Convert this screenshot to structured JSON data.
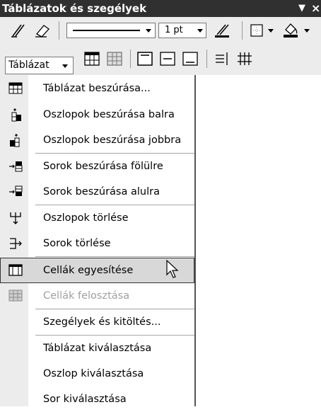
{
  "toolbar": {
    "title": "Táblázatok és szegélyek",
    "title_buttons": {
      "dropdown": "▼",
      "close": "×"
    },
    "line_weight": "1 pt",
    "tablazat_label": "Táblázat",
    "icons": [
      "pencil-icon",
      "eraser-icon",
      "line-style-dropdown",
      "line-weight-dropdown",
      "border-color-icon",
      "borders-icon",
      "shading-color-icon",
      "insert-table-icon",
      "merge-cells-icon",
      "split-cells-icon",
      "align-top-icon",
      "align-center-icon",
      "align-bottom-icon",
      "distribute-rows-icon",
      "distribute-columns-icon"
    ]
  },
  "menu": {
    "items": [
      {
        "label": "Táblázat beszúrása...",
        "icon": "insert-table-icon",
        "enabled": true
      },
      {
        "label": "Oszlopok beszúrása balra",
        "icon": "insert-columns-left-icon",
        "enabled": true
      },
      {
        "label": "Oszlopok beszúrása jobbra",
        "icon": "insert-columns-right-icon",
        "enabled": true
      },
      {
        "label": "Sorok beszúrása fölülre",
        "icon": "insert-rows-above-icon",
        "enabled": true
      },
      {
        "label": "Sorok beszúrása alulra",
        "icon": "insert-rows-below-icon",
        "enabled": true
      },
      {
        "label": "Oszlopok törlése",
        "icon": "delete-columns-icon",
        "enabled": true
      },
      {
        "label": "Sorok törlése",
        "icon": "delete-rows-icon",
        "enabled": true
      },
      {
        "label": "Cellák egyesítése",
        "icon": "merge-cells-icon",
        "enabled": true,
        "highlighted": true
      },
      {
        "label": "Cellák felosztása",
        "icon": "split-cells-icon",
        "enabled": false
      },
      {
        "label": "Szegélyek és kitöltés...",
        "icon": "",
        "enabled": true
      },
      {
        "label": "Táblázat kiválasztása",
        "icon": "",
        "enabled": true
      },
      {
        "label": "Oszlop kiválasztása",
        "icon": "",
        "enabled": true
      },
      {
        "label": "Sor kiválasztása",
        "icon": "",
        "enabled": true
      }
    ]
  }
}
